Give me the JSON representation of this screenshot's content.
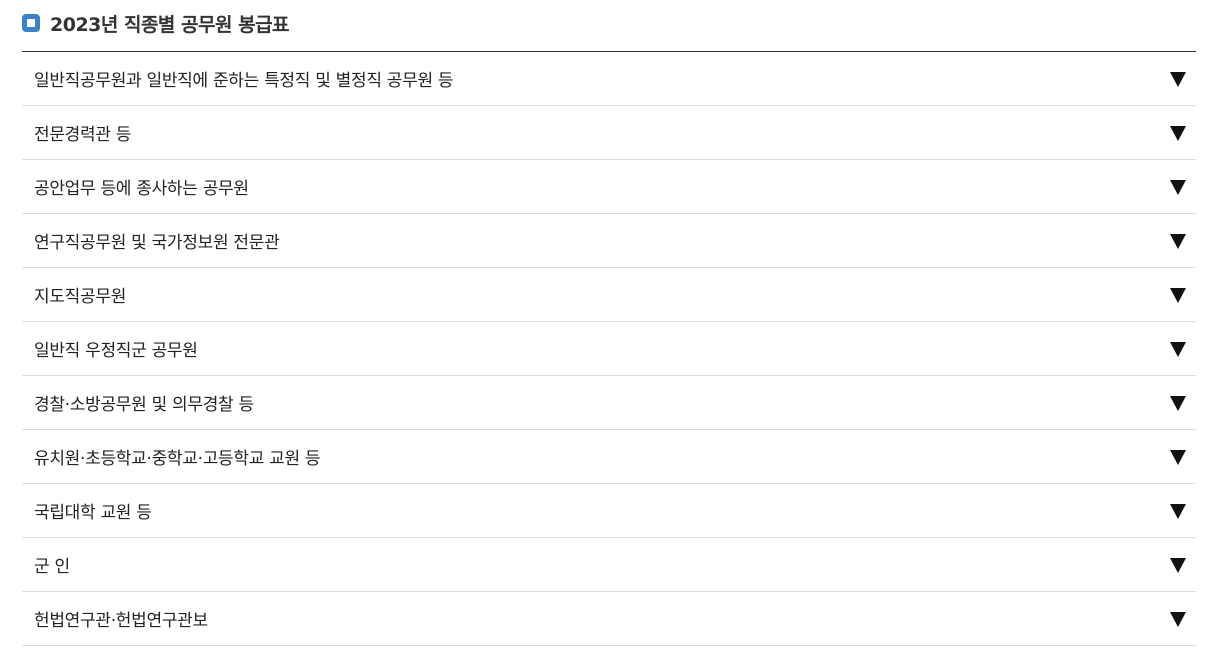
{
  "header": {
    "icon": "square-bullet-icon",
    "title": "2023년 직종별 공무원 봉급표",
    "accent_color": "#3b82c8"
  },
  "accordion": {
    "expand_icon": "triangle-down-icon",
    "items": [
      {
        "label": "일반직공무원과 일반직에 준하는 특정직 및 별정직 공무원 등"
      },
      {
        "label": "전문경력관 등"
      },
      {
        "label": "공안업무 등에 종사하는 공무원"
      },
      {
        "label": "연구직공무원 및 국가정보원 전문관"
      },
      {
        "label": "지도직공무원"
      },
      {
        "label": "일반직 우정직군 공무원"
      },
      {
        "label": "경찰·소방공무원 및 의무경찰 등"
      },
      {
        "label": "유치원·초등학교·중학교·고등학교 교원 등"
      },
      {
        "label": "국립대학 교원 등"
      },
      {
        "label": "군 인"
      },
      {
        "label": "헌법연구관·헌법연구관보"
      }
    ]
  }
}
